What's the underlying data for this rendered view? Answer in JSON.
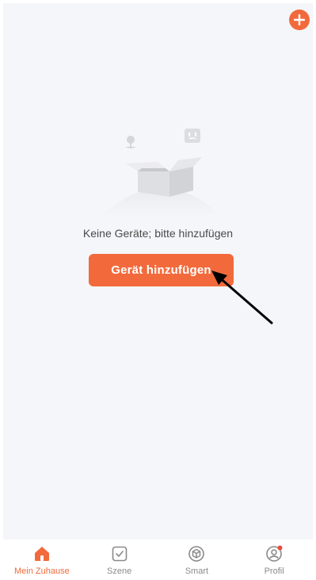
{
  "header": {
    "add_icon": "plus-icon"
  },
  "empty_state": {
    "illustration_icon": "empty-box-icon",
    "message": "Keine Geräte; bitte hinzufügen",
    "button_label": "Gerät hinzufügen"
  },
  "tabbar": {
    "items": [
      {
        "label": "Mein Zuhause",
        "icon": "home-icon",
        "active": true
      },
      {
        "label": "Szene",
        "icon": "scene-check-icon",
        "active": false
      },
      {
        "label": "Smart",
        "icon": "smart-cube-icon",
        "active": false
      },
      {
        "label": "Profil",
        "icon": "profile-icon",
        "active": false,
        "badge": true
      }
    ]
  },
  "colors": {
    "accent": "#f26a3b",
    "background": "#f5f6fa",
    "inactive": "#8a8a8a",
    "badge": "#e74c3c"
  }
}
